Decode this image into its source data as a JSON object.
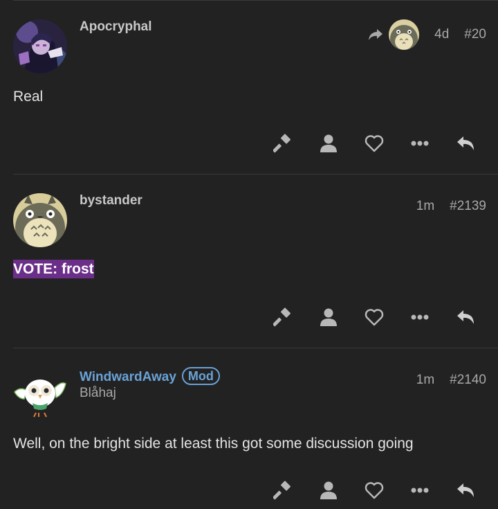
{
  "posts": [
    {
      "username": "Apocryphal",
      "age": "4d",
      "number": "#20",
      "body": "Real",
      "has_reply_to": true
    },
    {
      "username": "bystander",
      "age": "1m",
      "number": "#2139",
      "body": "VOTE: frost"
    },
    {
      "username": "WindwardAway",
      "badge": "Mod",
      "user_title": "Blåhaj",
      "age": "1m",
      "number": "#2140",
      "body": "Well, on the bright side at least this got some discussion going"
    }
  ],
  "icons": {
    "flag": "gavel-icon",
    "user": "user-icon",
    "like": "heart-icon",
    "more": "ellipsis-icon",
    "reply": "reply-icon",
    "reply_to": "share-arrow-icon"
  },
  "colors": {
    "background": "#222222",
    "mod_accent": "#6aa2d6",
    "vote_highlight": "#6b2f8a"
  }
}
